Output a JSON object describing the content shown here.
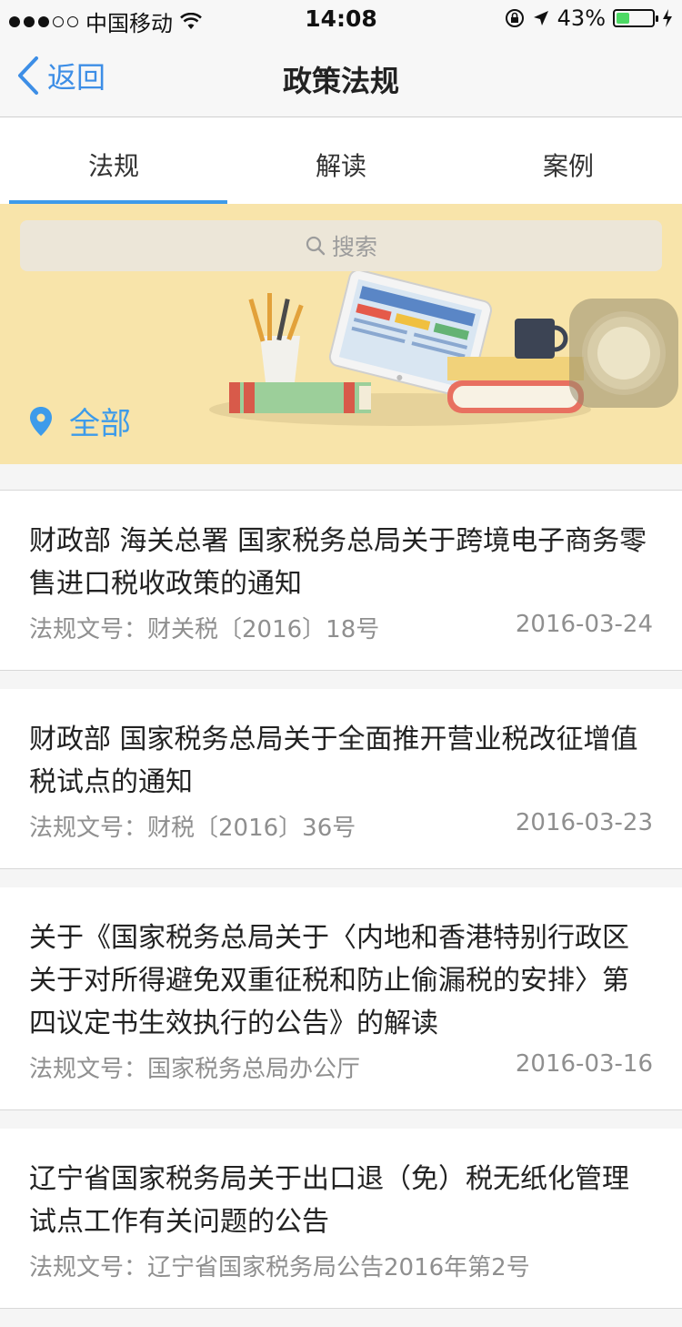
{
  "status_bar": {
    "carrier": "中国移动",
    "time": "14:08",
    "battery": "43%",
    "battery_level": 0.43
  },
  "nav": {
    "back_label": "返回",
    "title": "政策法规"
  },
  "tabs": [
    {
      "label": "法规"
    },
    {
      "label": "解读"
    },
    {
      "label": "案例"
    }
  ],
  "banner": {
    "search_placeholder": "搜索",
    "location_label": "全部"
  },
  "list": [
    {
      "title": "财政部 海关总署 国家税务总局关于跨境电子商务零售进口税收政策的通知",
      "doc_no": "法规文号：财关税〔2016〕18号",
      "date": "2016-03-24"
    },
    {
      "title": "财政部 国家税务总局关于全面推开营业税改征增值税试点的通知",
      "doc_no": "法规文号：财税〔2016〕36号",
      "date": "2016-03-23"
    },
    {
      "title": "关于《国家税务总局关于〈内地和香港特别行政区关于对所得避免双重征税和防止偷漏税的安排〉第四议定书生效执行的公告》的解读",
      "doc_no": "法规文号：国家税务总局办公厅",
      "date": "2016-03-16"
    },
    {
      "title": "辽宁省国家税务局关于出口退（免）税无纸化管理试点工作有关问题的公告",
      "doc_no": "法规文号：辽宁省国家税务局公告2016年第2号",
      "date": ""
    }
  ]
}
